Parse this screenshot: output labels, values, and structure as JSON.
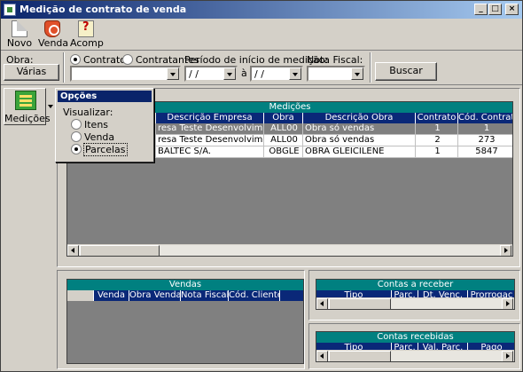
{
  "window": {
    "title": "Medição de contrato de venda",
    "min": "_",
    "max": "□",
    "close": "×"
  },
  "toolbar": [
    {
      "label": "Novo",
      "icon": "new-document-icon"
    },
    {
      "label": "Venda",
      "icon": "sale-icon"
    },
    {
      "label": "Acomp",
      "icon": "help-icon"
    }
  ],
  "filters": {
    "obra_label": "Obra:",
    "obra_button": "Várias",
    "radio_contratos": "Contratos",
    "radio_contratantes": "Contratantes",
    "periodo_label": "Período de início de medição:",
    "date_from": " / /",
    "date_sep": "à",
    "date_to": " / /",
    "nota_label": "Nota Fiscal:",
    "buscar": "Buscar"
  },
  "sidebar": {
    "label": "Medições"
  },
  "popup": {
    "title": "Opções",
    "visualizar": "Visualizar:",
    "options": [
      "Itens",
      "Venda",
      "Parcelas"
    ],
    "selected": "Parcelas"
  },
  "medicoes": {
    "title": "Medições",
    "columns": [
      "Descrição Empresa",
      "Obra",
      "Descrição Obra",
      "Contrato",
      "Cód. Contratante"
    ],
    "rows": [
      [
        "resa Teste Desenvolvimento",
        "ALL00",
        "Obra só vendas",
        "1",
        "1"
      ],
      [
        "resa Teste Desenvolvimento",
        "ALL00",
        "Obra só vendas",
        "2",
        "273"
      ],
      [
        "BALTEC S/A.",
        "OBGLE",
        "OBRA GLEICILENE",
        "1",
        "5847"
      ]
    ]
  },
  "vendas": {
    "title": "Vendas",
    "columns": [
      "",
      "Venda",
      "Obra Venda",
      "Nota Fiscal",
      "Cód. Cliente"
    ]
  },
  "contas_receber": {
    "title": "Contas a receber",
    "columns": [
      "Tipo",
      "Parc.",
      "Dt. Venc.",
      "Prorrogaç"
    ]
  },
  "contas_recebidas": {
    "title": "Contas recebidas",
    "columns": [
      "Tipo",
      "Parc.",
      "Val. Parc.",
      "Pago"
    ]
  }
}
